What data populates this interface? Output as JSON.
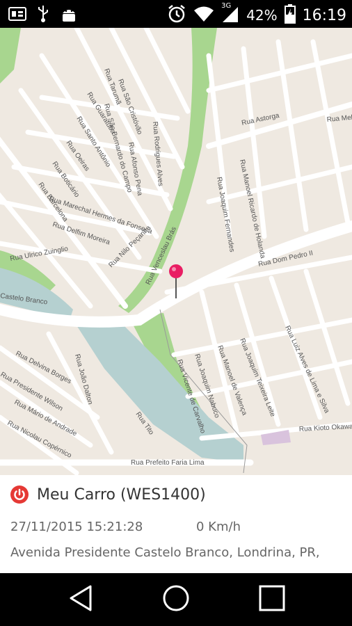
{
  "status_bar": {
    "battery_percent": "42%",
    "time": "16:19",
    "network_type": "3G",
    "icons": [
      "sim-icon",
      "usb-icon",
      "android-icon",
      "alarm-icon",
      "wifi-icon",
      "signal-icon",
      "battery-charging-icon"
    ]
  },
  "map": {
    "street_labels": [
      "Rua Tarumã",
      "Rua São Cristóvão",
      "Rua Guaratuba",
      "Rua Santo Antônio",
      "Rua Oeiras",
      "Rua Boticário",
      "Rua Barcelona",
      "Rua Marechal Hermes da Fonseca",
      "Rua Delfim Moreira",
      "Rua São Bernardo do Campo",
      "Rua Afonso Pena",
      "Rua Rodrigues Alves",
      "Rua Nilo Peçanha",
      "Rua Venceslau Brás",
      "Rua Astorga",
      "Rua Manoel Ricardo de Holanda",
      "Rua Joaquim Fernandes",
      "Rua Dom Pedro II",
      "Rua Ulrico Zuinglio",
      "Rua Vicente de Carvalho",
      "Rua Joaquim Nabuco",
      "Rua Manoel de Valença",
      "Rua Joaquim Teixeira Leite",
      "Rua Luiz Alves de Lima e Silva",
      "Rua Kioto Okawa",
      "Rua Prefeito Faria Lima",
      "Rua Presidente Wilson",
      "Rua Delvina Borges",
      "Rua Mário de Andrade",
      "Rua Nicolau Copérnico",
      "Rua João Dalton",
      "Rua Tito",
      "Castelo Branco",
      "Rua Mel"
    ],
    "colors": {
      "land": "#efe9e1",
      "park": "#a8d68f",
      "water": "#b5d0d0",
      "road": "#ffffff",
      "marker": "#e91e63"
    }
  },
  "panel": {
    "vehicle_name": "Meu Carro (WES1400)",
    "datetime": "27/11/2015 15:21:28",
    "speed": "0 Km/h",
    "address": "Avenida Presidente Castelo Branco, Londrina, PR,",
    "status_color": "#e53935"
  },
  "nav": {
    "icons": [
      "back-icon",
      "home-icon",
      "recents-icon"
    ]
  }
}
